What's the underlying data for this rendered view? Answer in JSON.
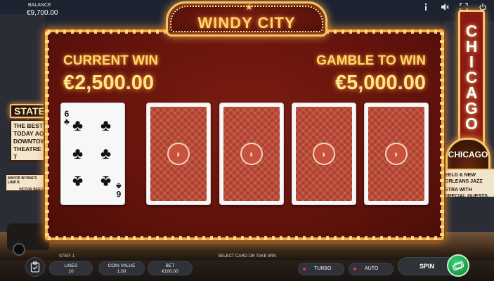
{
  "header": {
    "balance_label": "BALANCE",
    "balance_value": "€9,700.00",
    "icons": [
      "info-icon",
      "sound-icon",
      "fullscreen-icon",
      "power-icon"
    ]
  },
  "scenery": {
    "left_sign": "STATE L",
    "left_marquee": [
      "THE BEST",
      "TODAY AG",
      "DOWNTOWN",
      "THEATRE T"
    ],
    "left_marquee_2": [
      "MAYOR BYRNE'S LIMP B",
      "VICTOR BERGE"
    ],
    "right_sign": "CHICAGO",
    "right_arch": "CHICAGO",
    "right_marquee": [
      "EELD & NEW ORLEANS JAZZ",
      "STRA WITH SPECIAL GUESTS"
    ]
  },
  "game": {
    "title": "WINDY CITY",
    "current_win_label": "CURRENT WIN",
    "current_win_value": "€2,500.00",
    "gamble_label": "GAMBLE TO WIN",
    "gamble_value": "€5,000.00",
    "revealed_card": {
      "rank": "6",
      "suit": "♣"
    },
    "hidden_cards": 4,
    "card_back_color": "#b2402c"
  },
  "footer": {
    "step_label": "STEP: 1",
    "instruction": "SELECT CARD OR TAKE WIN",
    "lines_label": "LINES",
    "lines_value": "10",
    "coin_label": "COIN VALUE",
    "coin_value": "1.00",
    "bet_label": "BET",
    "bet_value": "€100.00",
    "turbo_label": "TURBO",
    "auto_label": "AUTO",
    "spin_label": "SPIN",
    "spin_color": "#1b9b4a"
  }
}
